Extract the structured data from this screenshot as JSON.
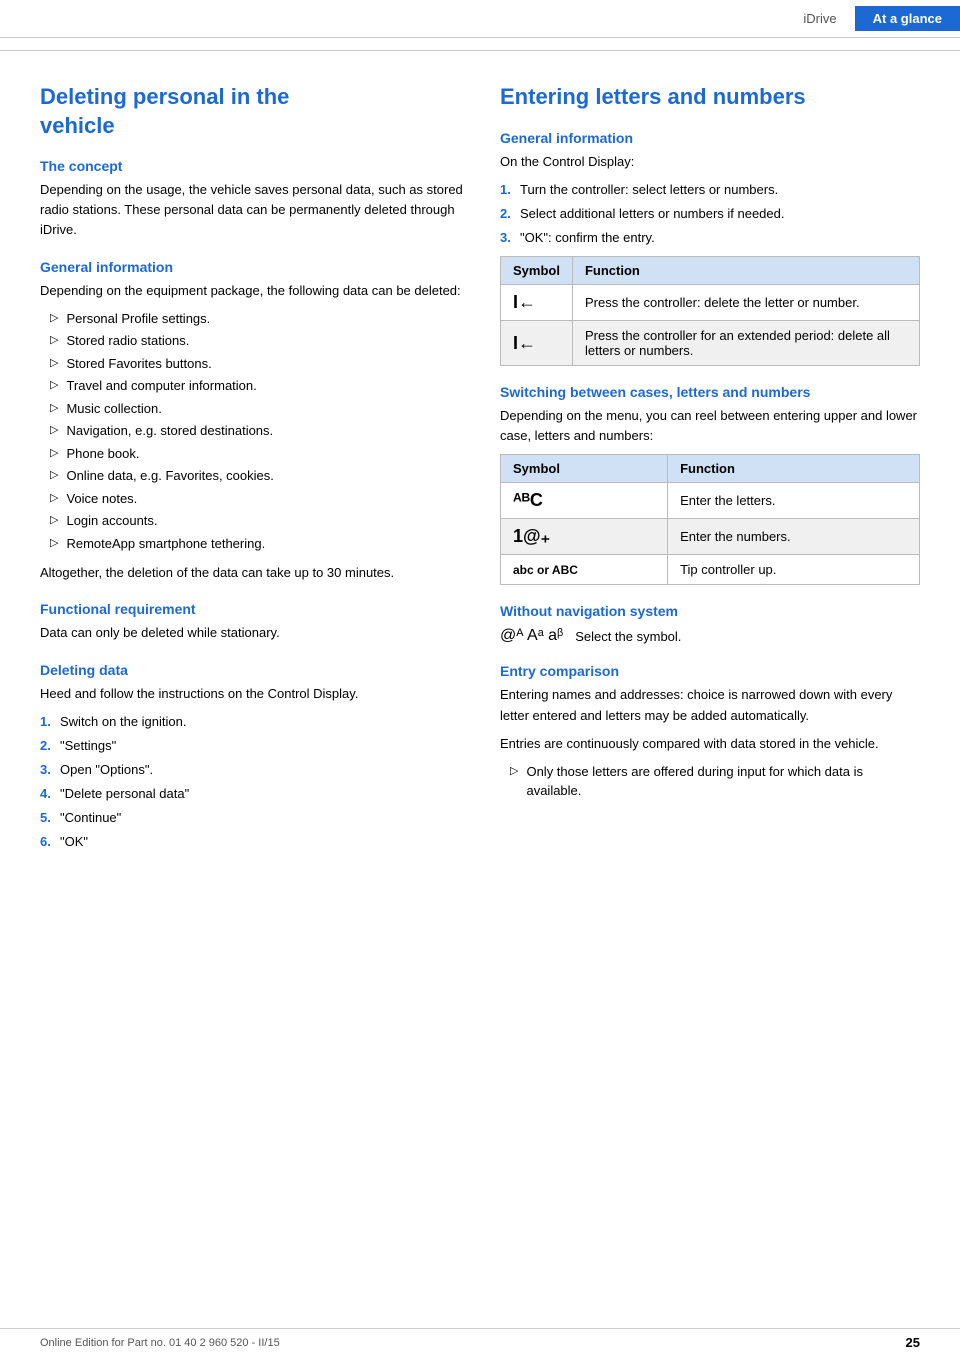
{
  "header": {
    "tab1_label": "iDrive",
    "tab2_label": "At a glance"
  },
  "left": {
    "page_title_line1": "Deleting personal in the",
    "page_title_line2": "vehicle",
    "concept_heading": "The concept",
    "concept_body": "Depending on the usage, the vehicle saves personal data, such as stored radio stations. These personal data can be permanently deleted through iDrive.",
    "general_info_heading": "General information",
    "general_info_body": "Depending on the equipment package, the following data can be deleted:",
    "bullet_items": [
      "Personal Profile settings.",
      "Stored radio stations.",
      "Stored Favorites buttons.",
      "Travel and computer information.",
      "Music collection.",
      "Navigation, e.g. stored destinations.",
      "Phone book.",
      "Online data, e.g. Favorites, cookies.",
      "Voice notes.",
      "Login accounts.",
      "RemoteApp smartphone tethering."
    ],
    "general_info_footer": "Altogether, the deletion of the data can take up to 30 minutes.",
    "functional_req_heading": "Functional requirement",
    "functional_req_body": "Data can only be deleted while stationary.",
    "deleting_data_heading": "Deleting data",
    "deleting_data_body": "Heed and follow the instructions on the Control Display.",
    "steps": [
      {
        "num": "1.",
        "text": "Switch on the ignition."
      },
      {
        "num": "2.",
        "text": "\"Settings\""
      },
      {
        "num": "3.",
        "text": "Open \"Options\"."
      },
      {
        "num": "4.",
        "text": "\"Delete personal data\""
      },
      {
        "num": "5.",
        "text": "\"Continue\""
      },
      {
        "num": "6.",
        "text": "\"OK\""
      }
    ]
  },
  "right": {
    "page_title": "Entering letters and numbers",
    "general_info_heading": "General information",
    "general_info_intro": "On the Control Display:",
    "steps": [
      {
        "num": "1.",
        "text": "Turn the controller: select letters or numbers."
      },
      {
        "num": "2.",
        "text": "Select additional letters or numbers if needed."
      },
      {
        "num": "3.",
        "text": "\"OK\": confirm the entry."
      }
    ],
    "table1": {
      "col1": "Symbol",
      "col2": "Function",
      "rows": [
        {
          "symbol": "I←",
          "function": "Press the controller: delete the letter or number."
        },
        {
          "symbol": "I←",
          "function": "Press the controller for an extended period: delete all letters or numbers."
        }
      ]
    },
    "switching_heading": "Switching between cases, letters and numbers",
    "switching_body": "Depending on the menu, you can reel between entering upper and lower case, letters and numbers:",
    "table2": {
      "col1": "Symbol",
      "col2": "Function",
      "rows": [
        {
          "symbol": "ᴬᴮC",
          "function": "Enter the letters."
        },
        {
          "symbol": "1@₊",
          "function": "Enter the numbers."
        },
        {
          "symbol": "abc or ABC",
          "function": "Tip controller up."
        }
      ]
    },
    "without_nav_heading": "Without navigation system",
    "without_nav_symbols": "@ᴬ  Aᵃ  aᵝ",
    "without_nav_text": "Select the symbol.",
    "entry_comparison_heading": "Entry comparison",
    "entry_comparison_body1": "Entering names and addresses: choice is narrowed down with every letter entered and letters may be added automatically.",
    "entry_comparison_body2": "Entries are continuously compared with data stored in the vehicle.",
    "entry_comparison_bullet": "Only those letters are offered during input for which data is available."
  },
  "footer": {
    "left_text": "Online Edition for Part no. 01 40 2 960 520 - II/15",
    "page_number": "25"
  }
}
